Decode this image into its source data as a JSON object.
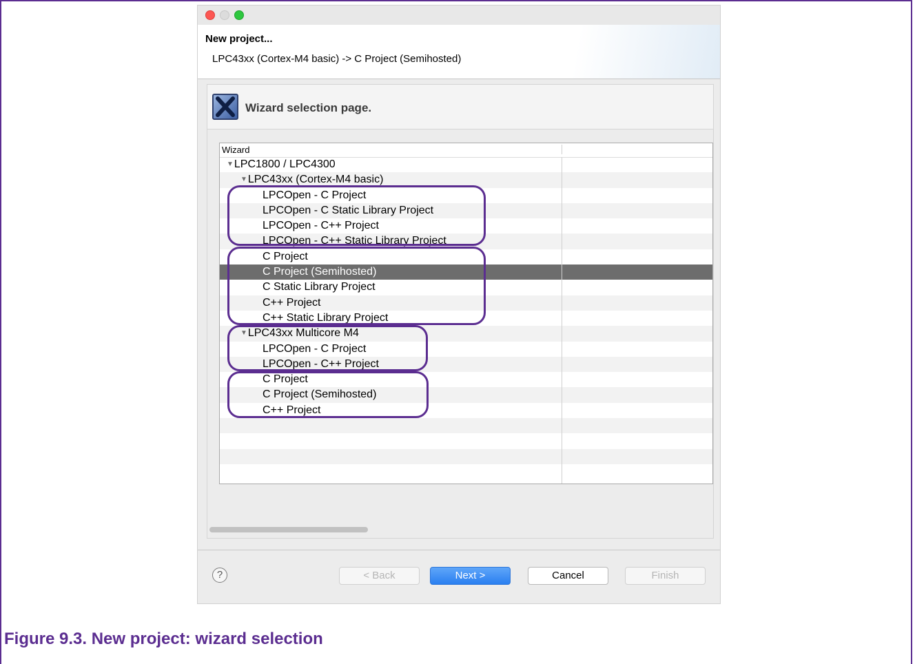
{
  "dialog": {
    "title": "New project...",
    "subtitle": "LPC43xx (Cortex-M4 basic) -> C Project (Semihosted)"
  },
  "banner": {
    "title": "Wizard selection page."
  },
  "tree": {
    "column_header": "Wizard",
    "rows": [
      {
        "label": "LPC1800 / LPC4300",
        "level": 0,
        "expanded": true
      },
      {
        "label": "LPC43xx (Cortex-M4 basic)",
        "level": 1,
        "expanded": true
      },
      {
        "label": "LPCOpen - C Project",
        "level": 2
      },
      {
        "label": "LPCOpen - C Static Library Project",
        "level": 2
      },
      {
        "label": "LPCOpen - C++ Project",
        "level": 2
      },
      {
        "label": "LPCOpen - C++ Static Library Project",
        "level": 2
      },
      {
        "label": "C Project",
        "level": 2
      },
      {
        "label": "C Project (Semihosted)",
        "level": 2,
        "selected": true
      },
      {
        "label": "C Static Library Project",
        "level": 2
      },
      {
        "label": "C++ Project",
        "level": 2
      },
      {
        "label": "C++ Static Library Project",
        "level": 2
      },
      {
        "label": "LPC43xx Multicore M4",
        "level": 1,
        "expanded": true
      },
      {
        "label": "LPCOpen - C Project",
        "level": 2
      },
      {
        "label": "LPCOpen - C++ Project",
        "level": 2
      },
      {
        "label": "C Project",
        "level": 2
      },
      {
        "label": "C Project (Semihosted)",
        "level": 2
      },
      {
        "label": "C++ Project",
        "level": 2
      }
    ]
  },
  "buttons": {
    "back": "< Back",
    "next": "Next >",
    "cancel": "Cancel",
    "finish": "Finish",
    "help": "?"
  },
  "caption": "Figure 9.3. New project: wizard selection",
  "colors": {
    "highlight_outline": "#5b2d90",
    "selected_row": "#6d6d6d",
    "primary_button": "#2a7ff0"
  }
}
